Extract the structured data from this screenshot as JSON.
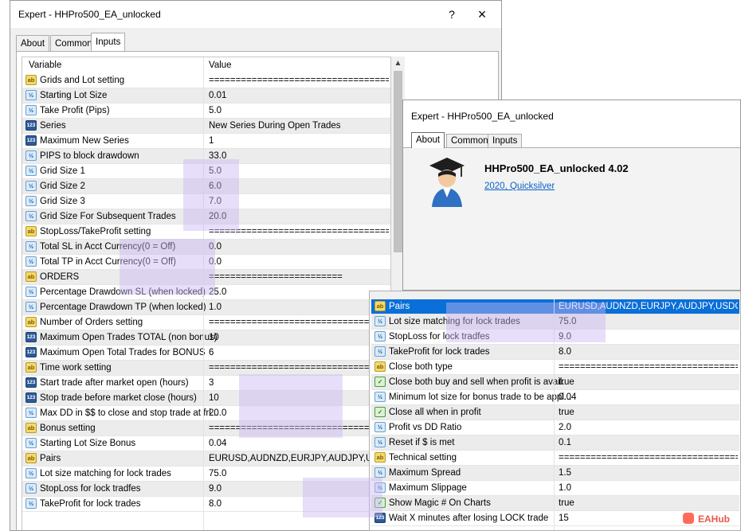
{
  "window_main": {
    "title": "Expert - HHPro500_EA_unlocked",
    "help_button": "?",
    "close_button": "×",
    "tabs": [
      "About",
      "Common",
      "Inputs"
    ],
    "active_tab": "Inputs",
    "col_variable": "Variable",
    "col_value": "Value",
    "rows": [
      {
        "icon": "ab",
        "label": "Grids and Lot setting",
        "value": "========================================..."
      },
      {
        "icon": "vd",
        "label": "Starting Lot Size",
        "value": "0.01"
      },
      {
        "icon": "vd",
        "label": "Take Profit (Pips)",
        "value": "5.0"
      },
      {
        "icon": "123",
        "label": "Series",
        "value": "New Series During Open Trades"
      },
      {
        "icon": "123",
        "label": "Maximum New Series",
        "value": "1"
      },
      {
        "icon": "vd",
        "label": "PIPS to block drawdown",
        "value": "33.0"
      },
      {
        "icon": "vd",
        "label": "Grid Size 1",
        "value": "5.0"
      },
      {
        "icon": "vd",
        "label": "Grid Size 2",
        "value": "6.0"
      },
      {
        "icon": "vd",
        "label": "Grid Size 3",
        "value": "7.0"
      },
      {
        "icon": "vd",
        "label": "Grid Size For Subsequent Trades",
        "value": "20.0"
      },
      {
        "icon": "ab",
        "label": "StopLoss/TakeProfit setting",
        "value": "========================================..."
      },
      {
        "icon": "vd",
        "label": "Total SL in Acct Currency(0 = Off)",
        "value": "0.0"
      },
      {
        "icon": "vd",
        "label": "Total TP in Acct Currency(0 = Off)",
        "value": "0.0"
      },
      {
        "icon": "ab",
        "label": "ORDERS",
        "value": "========================="
      },
      {
        "icon": "vd",
        "label": "Percentage Drawdown SL (when locked)",
        "value": "25.0"
      },
      {
        "icon": "vd",
        "label": "Percentage Drawdown TP (when locked)",
        "value": "1.0"
      },
      {
        "icon": "ab",
        "label": "Number of Orders setting",
        "value": "========================================..."
      },
      {
        "icon": "123",
        "label": "Maximum Open Trades TOTAL (non bonus)",
        "value": "10"
      },
      {
        "icon": "123",
        "label": "Maximum Open Total Trades for BONUS",
        "value": "6"
      },
      {
        "icon": "ab",
        "label": "Time work setting",
        "value": "========================================..."
      },
      {
        "icon": "123",
        "label": "Start trade after market open (hours)",
        "value": "3"
      },
      {
        "icon": "123",
        "label": "Stop trade before market close (hours)",
        "value": "10"
      },
      {
        "icon": "vd",
        "label": "Max DD in $$ to close and stop trade at fri...",
        "value": "20.0"
      },
      {
        "icon": "ab",
        "label": "Bonus setting",
        "value": "========================================..."
      },
      {
        "icon": "vd",
        "label": "Starting Lot Size Bonus",
        "value": "0.04"
      },
      {
        "icon": "ab",
        "label": "Pairs",
        "value": "EURUSD,AUDNZD,EURJPY,AUDJPY,USDCHF"
      },
      {
        "icon": "vd",
        "label": "Lot size matching for lock trades",
        "value": "75.0"
      },
      {
        "icon": "vd",
        "label": "StopLoss for lock tradfes",
        "value": "9.0"
      },
      {
        "icon": "vd",
        "label": "TakeProfit for lock trades",
        "value": "8.0"
      }
    ]
  },
  "window_about": {
    "title": "Expert - HHPro500_EA_unlocked",
    "tabs": [
      "About",
      "Common",
      "Inputs"
    ],
    "active_tab": "About",
    "product_name": "HHPro500_EA_unlocked 4.02",
    "copyright_link": "2020, Quicksilver",
    "icon": "graduate-icon"
  },
  "window_inputs_crop": {
    "rows": [
      {
        "icon": "ab",
        "label": "Pairs",
        "value": "EURUSD,AUDNZD,EURJPY,AUDJPY,USDCHF",
        "selected": true
      },
      {
        "icon": "vd",
        "label": "Lot size matching for lock trades",
        "value": "75.0"
      },
      {
        "icon": "vd",
        "label": "StopLoss for lock tradfes",
        "value": "9.0"
      },
      {
        "icon": "vd",
        "label": "TakeProfit for lock trades",
        "value": "8.0"
      },
      {
        "icon": "ab",
        "label": "Close both type",
        "value": "========================================..."
      },
      {
        "icon": "bool",
        "label": "Close both buy and sell when profit is avail.",
        "value": "true"
      },
      {
        "icon": "vd",
        "label": "Minimum lot size for bonus trade to be appl...",
        "value": "0.04"
      },
      {
        "icon": "bool",
        "label": "Close all when in profit",
        "value": "true"
      },
      {
        "icon": "vd",
        "label": "Profit vs DD Ratio",
        "value": "2.0"
      },
      {
        "icon": "vd",
        "label": "Reset if $ is met",
        "value": "0.1"
      },
      {
        "icon": "ab",
        "label": "Technical setting",
        "value": "========================================..."
      },
      {
        "icon": "vd",
        "label": "Maximum Spread",
        "value": "1.5"
      },
      {
        "icon": "vd",
        "label": "Maximum Slippage",
        "value": "1.0"
      },
      {
        "icon": "bool",
        "label": "Show Magic # On Charts",
        "value": "true"
      },
      {
        "icon": "123",
        "label": "Wait X minutes after losing LOCK trade",
        "value": "15"
      }
    ]
  },
  "watermark": {
    "text": "EAHub"
  },
  "icon_text": {
    "ab": "ab",
    "vd": "½",
    "123": "123",
    "bool": "✓"
  }
}
